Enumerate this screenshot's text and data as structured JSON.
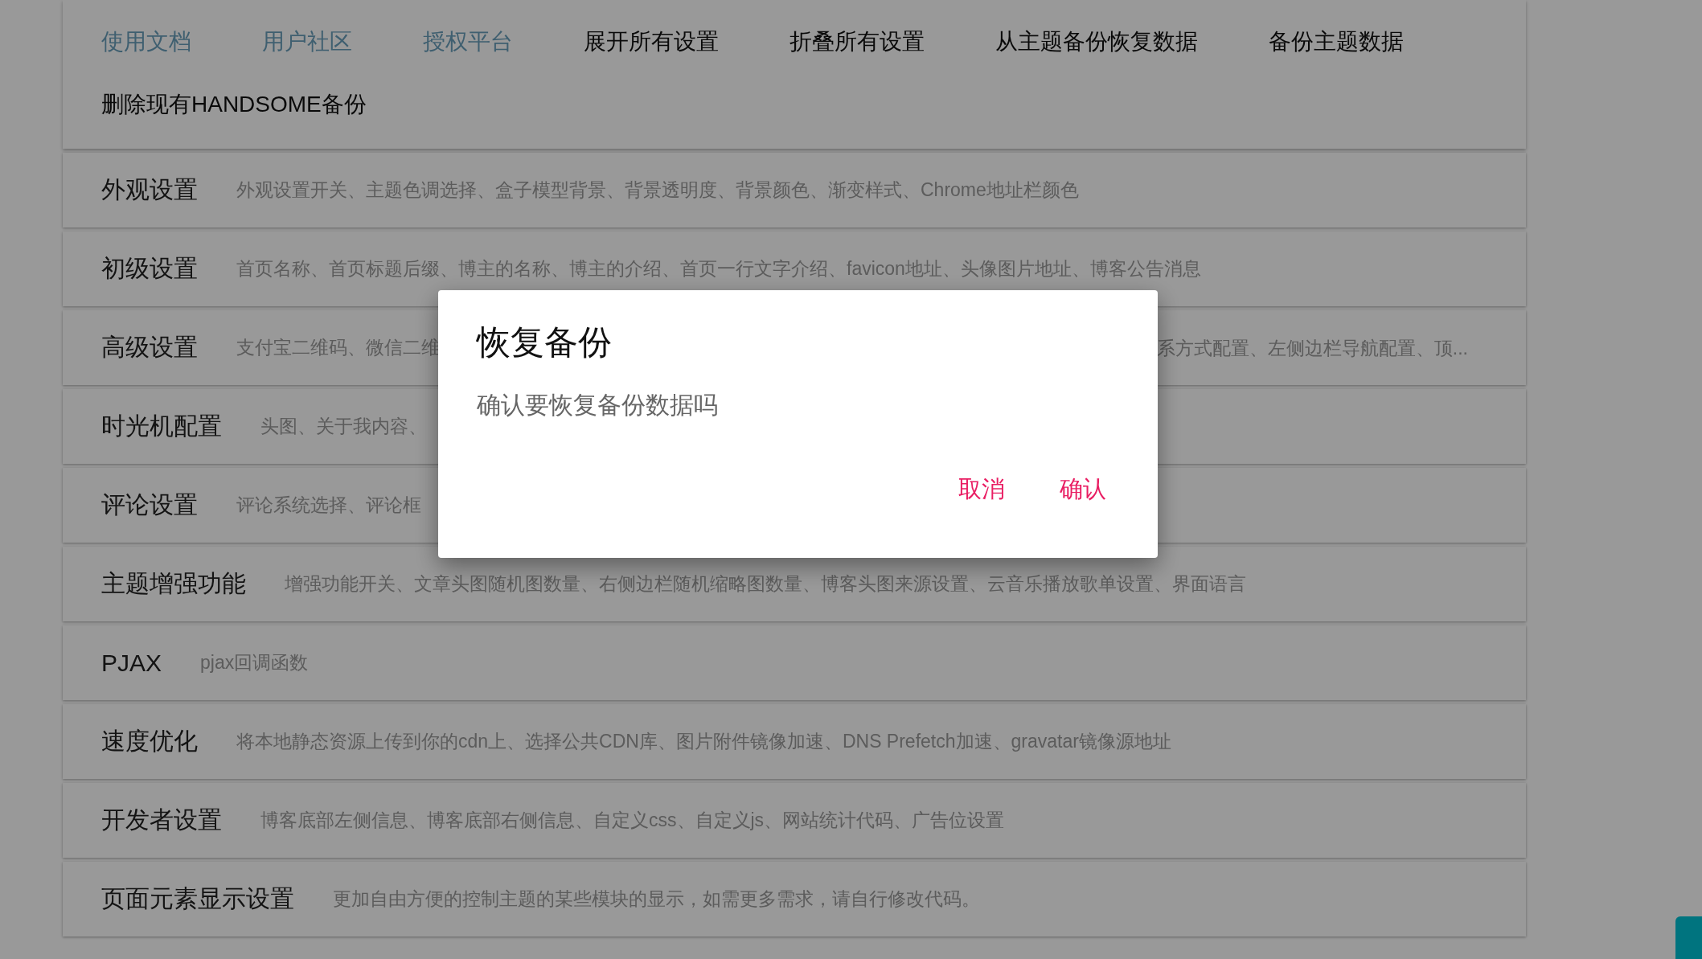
{
  "toolbar": {
    "links": [
      {
        "label": "使用文档",
        "kind": "link"
      },
      {
        "label": "用户社区",
        "kind": "link"
      },
      {
        "label": "授权平台",
        "kind": "link"
      },
      {
        "label": "展开所有设置",
        "kind": "action"
      },
      {
        "label": "折叠所有设置",
        "kind": "action"
      },
      {
        "label": "从主题备份恢复数据",
        "kind": "action"
      },
      {
        "label": "备份主题数据",
        "kind": "action"
      },
      {
        "label": "删除现有HANDSOME备份",
        "kind": "action"
      }
    ]
  },
  "sections": [
    {
      "title": "外观设置",
      "desc": "外观设置开关、主题色调选择、盒子模型背景、背景透明度、背景颜色、渐变样式、Chrome地址栏颜色"
    },
    {
      "title": "初级设置",
      "desc": "首页名称、首页标题后缀、博主的名称、博主的介绍、首页一行文字介绍、favicon地址、头像图片地址、博客公告消息"
    },
    {
      "title": "高级设置",
      "desc": "支付宝二维码、微信二维",
      "desc_after": "系方式配置、左侧边栏导航配置、顶..."
    },
    {
      "title": "时光机配置",
      "desc": "头图、关于我内容、"
    },
    {
      "title": "评论设置",
      "desc": "评论系统选择、评论框"
    },
    {
      "title": "主题增强功能",
      "desc": "增强功能开关、文章头图随机图数量、右侧边栏随机缩略图数量、博客头图来源设置、云音乐播放歌单设置、界面语言"
    },
    {
      "title": "PJAX",
      "desc": "pjax回调函数"
    },
    {
      "title": "速度优化",
      "desc": "将本地静态资源上传到你的cdn上、选择公共CDN库、图片附件镜像加速、DNS Prefetch加速、gravatar镜像源地址"
    },
    {
      "title": "开发者设置",
      "desc": "博客底部左侧信息、博客底部右侧信息、自定义css、自定义js、网站统计代码、广告位设置"
    },
    {
      "title": "页面元素显示设置",
      "desc": "更加自由方便的控制主题的某些模块的显示，如需更多需求，请自行修改代码。"
    }
  ],
  "dialog": {
    "title": "恢复备份",
    "message": "确认要恢复备份数据吗",
    "buttons": [
      "取消",
      "确认"
    ]
  }
}
